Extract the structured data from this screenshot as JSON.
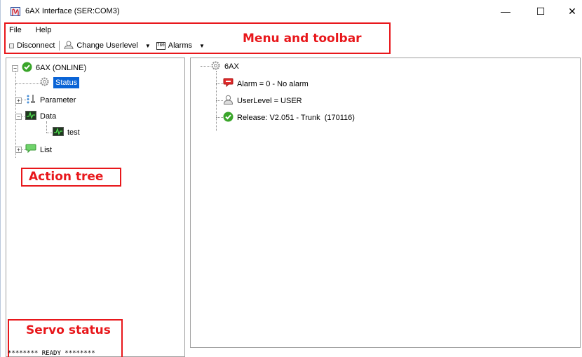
{
  "window": {
    "title": "6AX Interface (SER:COM3)",
    "minimize": "—",
    "maximize": "☐",
    "close": "✕"
  },
  "menu": {
    "file": "File",
    "help": "Help"
  },
  "toolbar": {
    "disconnect": "Disconnect",
    "change_userlevel": "Change Userlevel",
    "alarms": "Alarms",
    "alarms_icon_text": "780"
  },
  "annotations": {
    "menu_toolbar": "Menu and toolbar",
    "action_tree": "Action tree",
    "servo_status": "Servo status"
  },
  "tree": {
    "root": "6AX (ONLINE)",
    "status": "Status",
    "parameter": "Parameter",
    "data": "Data",
    "data_child": "test",
    "list": "List"
  },
  "details": {
    "root": "6AX",
    "alarm": "Alarm = 0 - No alarm",
    "userlevel": "UserLevel = USER",
    "release": "Release: V2.051 - Trunk  (170116)"
  },
  "status_bar": {
    "text": "******** READY ********"
  },
  "colors": {
    "annotation": "#e8171b",
    "selection": "#0a64d6"
  }
}
